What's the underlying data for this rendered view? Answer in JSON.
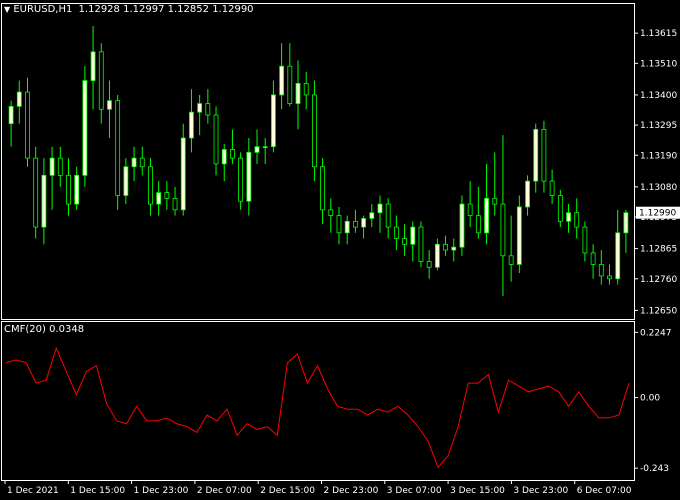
{
  "chart_data": [
    {
      "type": "candlestick",
      "symbol": "EURUSD,H1",
      "header_values": [
        "1.12928",
        "1.12997",
        "1.12852",
        "1.12990"
      ],
      "current_price": 1.1299,
      "current_price_label": "1.12990",
      "ylim": [
        1.1262,
        1.1372
      ],
      "y_ticks": [
        "1.13615",
        "1.13510",
        "1.13400",
        "1.13295",
        "1.13190",
        "1.13080",
        "1.12975",
        "1.12865",
        "1.12760",
        "1.12650"
      ],
      "x_ticks": [
        "1 Dec 2021",
        "1 Dec 15:00",
        "1 Dec 23:00",
        "2 Dec 07:00",
        "2 Dec 15:00",
        "2 Dec 23:00",
        "3 Dec 07:00",
        "3 Dec 15:00",
        "3 Dec 23:00",
        "6 Dec 07:00"
      ],
      "colors": {
        "bull": "#ffffdd",
        "bear": "#ffffdd",
        "wick": "#00ff00",
        "grid": "#ffffff"
      },
      "candles": [
        [
          1.133,
          1.1338,
          1.1322,
          1.1336
        ],
        [
          1.1336,
          1.1345,
          1.133,
          1.1341
        ],
        [
          1.1341,
          1.1346,
          1.1315,
          1.1318
        ],
        [
          1.1318,
          1.1322,
          1.129,
          1.1294
        ],
        [
          1.1294,
          1.1318,
          1.1288,
          1.1312
        ],
        [
          1.1312,
          1.1322,
          1.13,
          1.1318
        ],
        [
          1.1318,
          1.1322,
          1.1308,
          1.1312
        ],
        [
          1.1312,
          1.1318,
          1.1298,
          1.1302
        ],
        [
          1.1302,
          1.1315,
          1.13,
          1.1312
        ],
        [
          1.1312,
          1.135,
          1.1308,
          1.1345
        ],
        [
          1.1345,
          1.1364,
          1.1335,
          1.1355
        ],
        [
          1.1355,
          1.1358,
          1.133,
          1.1335
        ],
        [
          1.1335,
          1.1345,
          1.1325,
          1.1338
        ],
        [
          1.1338,
          1.134,
          1.13,
          1.1305
        ],
        [
          1.1305,
          1.1318,
          1.1302,
          1.1315
        ],
        [
          1.1315,
          1.1322,
          1.131,
          1.1318
        ],
        [
          1.1318,
          1.1322,
          1.1312,
          1.1315
        ],
        [
          1.1315,
          1.1318,
          1.1298,
          1.1302
        ],
        [
          1.1302,
          1.131,
          1.1298,
          1.1306
        ],
        [
          1.1306,
          1.131,
          1.13,
          1.1304
        ],
        [
          1.1304,
          1.1308,
          1.1298,
          1.13
        ],
        [
          1.13,
          1.133,
          1.1298,
          1.1325
        ],
        [
          1.1325,
          1.1342,
          1.132,
          1.1334
        ],
        [
          1.1334,
          1.134,
          1.1326,
          1.1337
        ],
        [
          1.1337,
          1.1342,
          1.133,
          1.1333
        ],
        [
          1.1333,
          1.1336,
          1.1312,
          1.1316
        ],
        [
          1.1316,
          1.1323,
          1.131,
          1.1321
        ],
        [
          1.1321,
          1.1328,
          1.1316,
          1.1318
        ],
        [
          1.1318,
          1.132,
          1.13,
          1.1303
        ],
        [
          1.1303,
          1.1325,
          1.1298,
          1.132
        ],
        [
          1.132,
          1.1328,
          1.1316,
          1.1322
        ],
        [
          1.1322,
          1.1325,
          1.1316,
          1.1322
        ],
        [
          1.1322,
          1.1345,
          1.132,
          1.134
        ],
        [
          1.134,
          1.1358,
          1.1335,
          1.135
        ],
        [
          1.135,
          1.1358,
          1.1336,
          1.1337
        ],
        [
          1.1337,
          1.1352,
          1.1328,
          1.1344
        ],
        [
          1.1344,
          1.1348,
          1.1335,
          1.134
        ],
        [
          1.134,
          1.1345,
          1.131,
          1.1315
        ],
        [
          1.1315,
          1.1318,
          1.1295,
          1.13
        ],
        [
          1.13,
          1.1304,
          1.1292,
          1.1298
        ],
        [
          1.1298,
          1.1301,
          1.1288,
          1.1292
        ],
        [
          1.1292,
          1.1298,
          1.1288,
          1.1296
        ],
        [
          1.1296,
          1.13,
          1.1292,
          1.1294
        ],
        [
          1.1294,
          1.1298,
          1.129,
          1.1297
        ],
        [
          1.1297,
          1.1302,
          1.1294,
          1.1299
        ],
        [
          1.1299,
          1.1305,
          1.1292,
          1.1302
        ],
        [
          1.1302,
          1.1304,
          1.129,
          1.1294
        ],
        [
          1.1294,
          1.1298,
          1.1286,
          1.129
        ],
        [
          1.129,
          1.1295,
          1.1284,
          1.1288
        ],
        [
          1.1288,
          1.1296,
          1.1282,
          1.1294
        ],
        [
          1.1294,
          1.1296,
          1.128,
          1.1282
        ],
        [
          1.1282,
          1.1286,
          1.1276,
          1.128
        ],
        [
          1.128,
          1.129,
          1.1279,
          1.1288
        ],
        [
          1.1288,
          1.1291,
          1.1284,
          1.1286
        ],
        [
          1.1286,
          1.129,
          1.1282,
          1.1287
        ],
        [
          1.1287,
          1.1305,
          1.1284,
          1.1302
        ],
        [
          1.1302,
          1.131,
          1.1294,
          1.1298
        ],
        [
          1.1298,
          1.1308,
          1.129,
          1.1292
        ],
        [
          1.1292,
          1.1316,
          1.1288,
          1.1304
        ],
        [
          1.1304,
          1.132,
          1.1298,
          1.1302
        ],
        [
          1.1302,
          1.1326,
          1.127,
          1.1284
        ],
        [
          1.1284,
          1.1298,
          1.1275,
          1.1281
        ],
        [
          1.1281,
          1.1305,
          1.1278,
          1.1301
        ],
        [
          1.1301,
          1.1312,
          1.1298,
          1.131
        ],
        [
          1.131,
          1.133,
          1.1306,
          1.1328
        ],
        [
          1.1328,
          1.1331,
          1.1306,
          1.131
        ],
        [
          1.131,
          1.1314,
          1.1302,
          1.1305
        ],
        [
          1.1305,
          1.1307,
          1.1294,
          1.1296
        ],
        [
          1.1296,
          1.1302,
          1.1292,
          1.1299
        ],
        [
          1.1299,
          1.1304,
          1.129,
          1.1294
        ],
        [
          1.1294,
          1.1296,
          1.1282,
          1.1285
        ],
        [
          1.1285,
          1.1288,
          1.1276,
          1.1281
        ],
        [
          1.1281,
          1.1286,
          1.1274,
          1.1277
        ],
        [
          1.1277,
          1.1281,
          1.1274,
          1.1276
        ],
        [
          1.1276,
          1.13,
          1.1274,
          1.1292
        ],
        [
          1.1292,
          1.13,
          1.1285,
          1.1299
        ]
      ]
    },
    {
      "type": "line",
      "title": "CMF(20) 0.0348",
      "ylim": [
        -0.27,
        0.25
      ],
      "y_ticks": [
        "0.2247",
        "0.00",
        "-0.243"
      ],
      "colors": {
        "line": "#ff0000"
      },
      "values": [
        0.12,
        0.13,
        0.12,
        0.05,
        0.06,
        0.17,
        0.09,
        0.01,
        0.09,
        0.11,
        -0.02,
        -0.08,
        -0.09,
        -0.03,
        -0.08,
        -0.08,
        -0.07,
        -0.09,
        -0.1,
        -0.12,
        -0.06,
        -0.08,
        -0.04,
        -0.13,
        -0.09,
        -0.11,
        -0.1,
        -0.13,
        0.12,
        0.15,
        0.05,
        0.11,
        0.03,
        -0.03,
        -0.04,
        -0.04,
        -0.06,
        -0.04,
        -0.05,
        -0.03,
        -0.06,
        -0.1,
        -0.15,
        -0.24,
        -0.2,
        -0.1,
        0.05,
        0.05,
        0.08,
        -0.05,
        0.06,
        0.04,
        0.02,
        0.03,
        0.04,
        0.02,
        -0.03,
        0.02,
        -0.03,
        -0.07,
        -0.07,
        -0.06,
        0.05
      ]
    }
  ]
}
